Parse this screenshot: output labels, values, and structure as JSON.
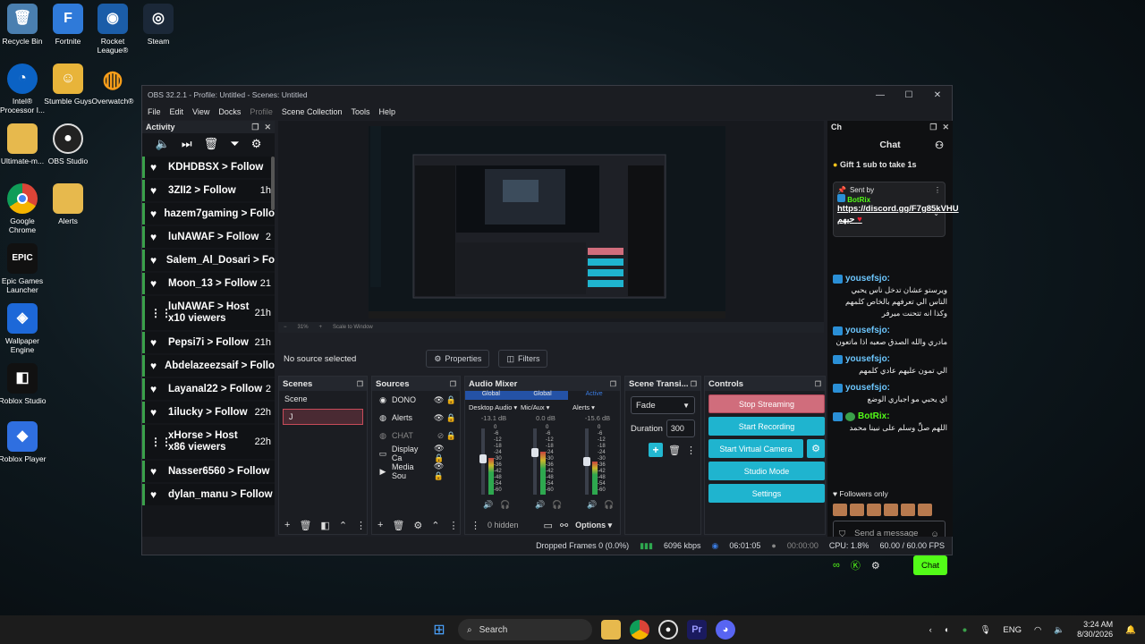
{
  "desktop": {
    "icons": [
      {
        "label": "Recycle Bin",
        "icon": "recycle-bin-icon"
      },
      {
        "label": "Fortnite",
        "icon": "fortnite-icon"
      },
      {
        "label": "Rocket League®",
        "icon": "rocket-league-icon"
      },
      {
        "label": "Steam",
        "icon": "steam-icon"
      },
      {
        "label": "Intel® Processor I...",
        "icon": "intel-icon"
      },
      {
        "label": "Stumble Guys",
        "icon": "stumble-guys-icon"
      },
      {
        "label": "Overwatch®",
        "icon": "overwatch-icon"
      },
      {
        "label": "Ultimate-m...",
        "icon": "folder-icon"
      },
      {
        "label": "OBS Studio",
        "icon": "obs-icon"
      },
      {
        "label": "Google Chrome",
        "icon": "chrome-icon"
      },
      {
        "label": "Alerts",
        "icon": "folder-icon"
      },
      {
        "label": "Epic Games Launcher",
        "icon": "epic-icon"
      },
      {
        "label": "Wallpaper Engine",
        "icon": "wallpaper-engine-icon"
      },
      {
        "label": "Roblox Studio",
        "icon": "roblox-studio-icon"
      },
      {
        "label": "Roblox Player",
        "icon": "roblox-player-icon"
      }
    ]
  },
  "window": {
    "title": "OBS 32.2.1 - Profile: Untitled - Scenes: Untitled",
    "menu": [
      "File",
      "Edit",
      "View",
      "Docks",
      "Profile",
      "Scene Collection",
      "Tools",
      "Help"
    ]
  },
  "activity": {
    "title": "Activity",
    "items": [
      {
        "text": "KDHDBSX > Follow",
        "time": ""
      },
      {
        "text": "3ZII2 > Follow",
        "time": "1h"
      },
      {
        "text": "hazem7gaming > Follo",
        "time": ""
      },
      {
        "text": "luNAWAF > Follow",
        "time": "2"
      },
      {
        "text": "Salem_Al_Dosari > Fo",
        "time": ""
      },
      {
        "text": "Moon_13 > Follow",
        "time": "21"
      },
      {
        "text": "luNAWAF > Host",
        "sub": "x10 viewers",
        "time": "21h"
      },
      {
        "text": "Pepsi7i > Follow",
        "time": "21h"
      },
      {
        "text": "Abdelazeezsaif > Follo",
        "time": ""
      },
      {
        "text": "Layanal22 > Follow",
        "time": "2"
      },
      {
        "text": "1ilucky > Follow",
        "time": "22h"
      },
      {
        "text": "xHorse > Host",
        "sub": "x86 viewers",
        "time": "22h"
      },
      {
        "text": "Nasser6560 > Follow",
        "time": ""
      },
      {
        "text": "dylan_manu > Follow",
        "time": ""
      }
    ]
  },
  "preview": {
    "zoom": "31%",
    "scale_mode": "Scale to Window"
  },
  "context": {
    "status": "No source selected",
    "properties": "Properties",
    "filters": "Filters"
  },
  "scenes": {
    "title": "Scenes",
    "items": [
      "Scene",
      "J"
    ]
  },
  "sources": {
    "title": "Sources",
    "items": [
      {
        "name": "DONO",
        "dim": false
      },
      {
        "name": "Alerts",
        "dim": false
      },
      {
        "name": "CHAT",
        "dim": true
      },
      {
        "name": "Display Ca",
        "dim": false
      },
      {
        "name": "Media Sou",
        "dim": false
      }
    ]
  },
  "mixer": {
    "title": "Audio Mixer",
    "header": [
      "Global",
      "Global",
      "Active"
    ],
    "channels": [
      {
        "name": "Desktop Audio",
        "db": "-13.1 dB",
        "level": 0.55
      },
      {
        "name": "Mic/Aux",
        "db": "0.0 dB",
        "level": 0.65
      },
      {
        "name": "Alerts",
        "db": "-15.6 dB",
        "level": 0.5
      }
    ],
    "scale": [
      "0",
      "-6",
      "-12",
      "-18",
      "-24",
      "-30",
      "-36",
      "-42",
      "-48",
      "-54",
      "-60"
    ],
    "hidden": "0 hidden",
    "options": "Options"
  },
  "transitions": {
    "title": "Scene Transi...",
    "selected": "Fade",
    "duration_label": "Duration",
    "duration_value": "300"
  },
  "controls": {
    "title": "Controls",
    "stop_streaming": "Stop Streaming",
    "start_recording": "Start Recording",
    "start_virtual_camera": "Start Virtual Camera",
    "studio_mode": "Studio Mode",
    "settings": "Settings"
  },
  "status": {
    "dropped": "Dropped Frames 0 (0.0%)",
    "bitrate": "6096 kbps",
    "stream_time": "06:01:05",
    "rec_time": "00:00:00",
    "cpu": "CPU: 1.8%",
    "fps": "60.00 / 60.00 FPS"
  },
  "chat": {
    "dock_title": "Ch",
    "title": "Chat",
    "gift": "Gift 1 sub to take 1s",
    "pinned_sent_by": "Sent by",
    "pinned_user": "BotRix",
    "pinned_link": "https://discord.gg/F7g85kVHU",
    "pinned_after": "حيهم",
    "messages": [
      {
        "user": "yousefsjo:",
        "text": "ويرستو عشان تدخل ناس يحبي الناس الي تعرفهم بالخاص كلمهم وكذا انه تتحنت ميرفر"
      },
      {
        "user": "yousefsjo:",
        "text": "مادري والله الصدق صعبه اذا ماتعون"
      },
      {
        "user": "yousefsjo:",
        "text": "الي تمون عليهم عادي كلمهم"
      },
      {
        "user": "yousefsjo:",
        "text": "اي يحبي مو اجباري الوضع"
      },
      {
        "user": "BotRix:",
        "text": "اللهم صلِّ وسلم على نبينا محمد"
      }
    ],
    "followers_only": "Followers only",
    "send_placeholder": "Send a message",
    "chat_button": "Chat"
  },
  "taskbar": {
    "search": "Search",
    "lang": "ENG",
    "time": "3:24 AM",
    "date": "8/30/2026"
  }
}
